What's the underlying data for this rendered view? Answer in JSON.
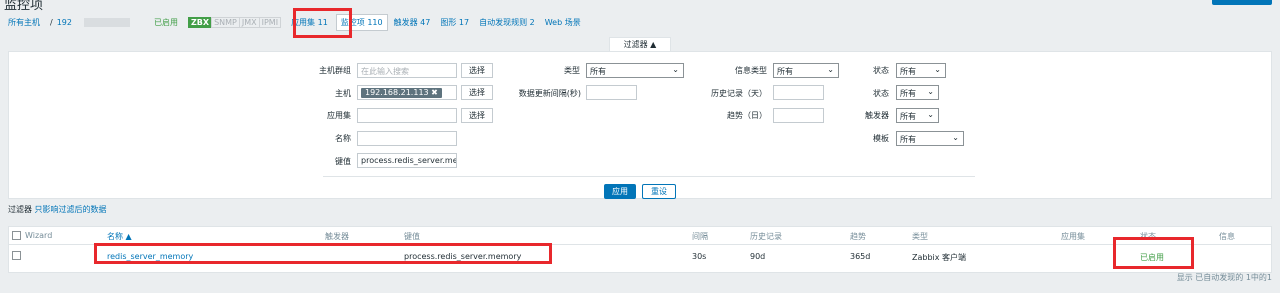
{
  "header": {
    "title": "监控项"
  },
  "nav": {
    "all_hosts": "所有主机",
    "separator": "/",
    "host_ip_prefix": "192",
    "enabled": "已启用",
    "zbx": "ZBX",
    "snmp": "SNMP",
    "jmx": "JMX",
    "ipmi": "IPMI",
    "applications": "应用集 11",
    "items": "监控项 110",
    "triggers": "触发器 47",
    "graphs": "图形 17",
    "discovery": "自动发现规则 2",
    "web": "Web 场景"
  },
  "filter": {
    "tab_label": "过滤器 ▲",
    "host_group_label": "主机群组",
    "host_group_placeholder": "在此输入搜索",
    "select_label": "选择",
    "host_label": "主机",
    "host_chip": "192.168.21.113 ✖",
    "application_label": "应用集",
    "name_label": "名称",
    "key_label": "键值",
    "key_value": "process.redis_server.mem",
    "type_label": "类型",
    "type_value": "所有",
    "update_interval_label": "数据更新间隔(秒)",
    "info_type_label": "信息类型",
    "info_type_value": "所有",
    "history_label": "历史记录（天）",
    "trends_label": "趋势（日）",
    "state_label": "状态",
    "state_value": "所有",
    "status_label": "状态",
    "status_value": "所有",
    "triggers_label": "触发器",
    "triggers_value": "所有",
    "template_label": "模板",
    "template_value": "所有",
    "apply": "应用",
    "reset": "重设",
    "note_prefix": "过滤器",
    "note_text": "只影响过滤后的数据"
  },
  "table": {
    "headers": {
      "wizard": "Wizard",
      "name": "名称 ▲",
      "triggers": "触发器",
      "key": "键值",
      "interval": "间隔",
      "history": "历史记录",
      "trends": "趋势",
      "type": "类型",
      "applications": "应用集",
      "status": "状态",
      "info": "信息"
    },
    "rows": [
      {
        "name": "redis_server_memory",
        "key": "process.redis_server.memory",
        "interval": "30s",
        "history": "90d",
        "trends": "365d",
        "type": "Zabbix 客户端",
        "status": "已启用"
      }
    ],
    "footer": "显示 已自动发现的 1中的1"
  },
  "colors": {
    "accent": "#0275b8",
    "enabled": "#429e47",
    "highlight_box": "#e8282c"
  }
}
